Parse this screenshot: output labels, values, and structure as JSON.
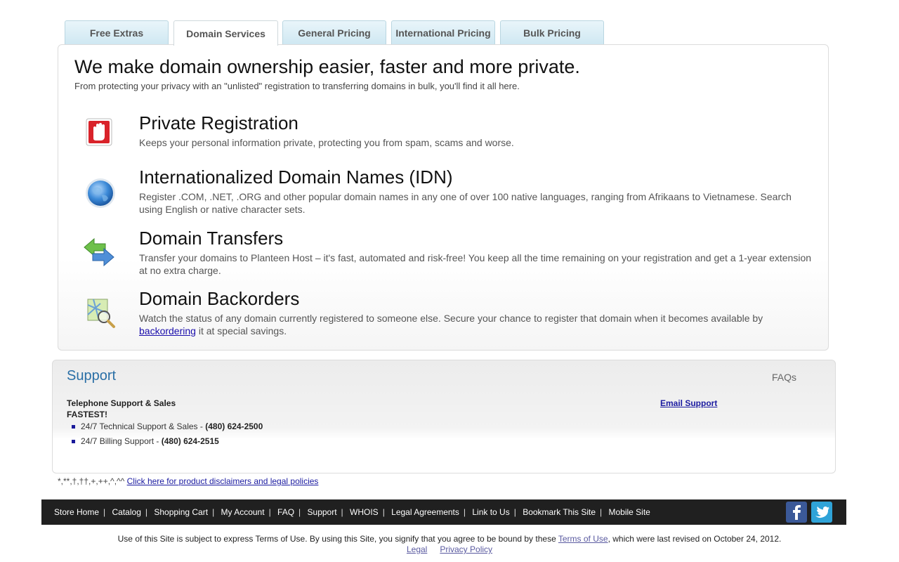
{
  "tabs": [
    {
      "label": "Free Extras"
    },
    {
      "label": "Domain Services"
    },
    {
      "label": "General Pricing"
    },
    {
      "label": "International Pricing"
    },
    {
      "label": "Bulk Pricing"
    }
  ],
  "active_tab": "Domain Services",
  "main": {
    "headline": "We make domain ownership easier, faster and more private.",
    "subline": "From protecting your privacy with an \"unlisted\" registration to transferring domains in bulk, you'll find it all here."
  },
  "features": [
    {
      "title": "Private Registration",
      "desc": "Keeps your personal information private, protecting you from spam, scams and worse.",
      "icon": "stop-hand-icon"
    },
    {
      "title": "Internationalized Domain Names (IDN)",
      "desc": "Register .COM, .NET, .ORG and other popular domain names in any one of over 100 native languages, ranging from Afrikaans to Vietnamese. Search using English or native character sets.",
      "icon": "globe-icon"
    },
    {
      "title": "Domain Transfers",
      "desc": "Transfer your domains to Planteen Host – it's fast, automated and risk-free! You keep all the time remaining on your registration and get a 1-year extension at no extra charge.",
      "icon": "transfer-arrows-icon"
    },
    {
      "title": "Domain Backorders",
      "desc_before": "Watch the status of any domain currently registered to someone else. Secure your chance to register that domain when it becomes available by ",
      "desc_link": "backordering",
      "desc_after": " it at special savings.",
      "icon": "map-search-icon"
    }
  ],
  "support": {
    "title": "Support",
    "faqs": "FAQs",
    "tel_heading": "Telephone Support & Sales",
    "fastest": "FASTEST!",
    "email_link": "Email Support",
    "lines": [
      {
        "label": "24/7 Technical Support & Sales - ",
        "phone": "(480) 624-2500"
      },
      {
        "label": "24/7 Billing Support - ",
        "phone": "(480) 624-2515"
      }
    ]
  },
  "disclaimer": {
    "symbols": "*,**,†,††,+,++,^,^^ ",
    "link": "Click here for product disclaimers and legal policies"
  },
  "footer_links": [
    "Store Home",
    "Catalog",
    "Shopping Cart",
    "My Account",
    "FAQ",
    "Support",
    "WHOIS",
    "Legal Agreements",
    "Link to Us",
    "Bookmark This Site",
    "Mobile Site"
  ],
  "social": [
    {
      "name": "facebook-icon",
      "glyph": "f",
      "color": "#3b5998"
    },
    {
      "name": "twitter-icon",
      "glyph": "t",
      "color": "#2fa3d8"
    }
  ],
  "terms": {
    "before": "Use of this Site is subject to express Terms of Use. By using this Site, you signify that you agree to be bound by these ",
    "link": "Terms of Use",
    "after": ", which were last revised on October 24, 2012."
  },
  "legal_links": [
    "Legal",
    "Privacy Policy"
  ]
}
